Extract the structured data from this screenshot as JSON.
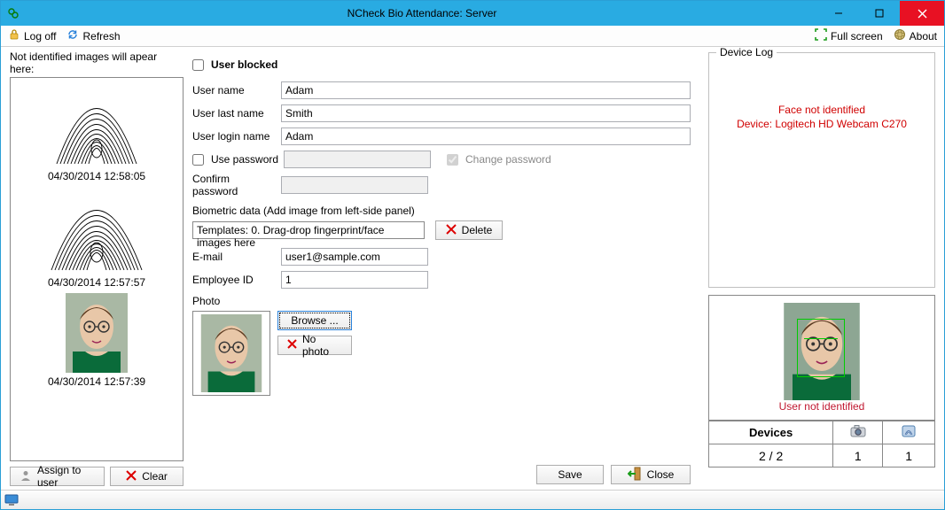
{
  "titlebar": {
    "title": "NCheck Bio Attendance: Server"
  },
  "toolbar": {
    "logoff": "Log off",
    "refresh": "Refresh",
    "fullscreen": "Full screen",
    "about": "About"
  },
  "left": {
    "header": "Not identified images will apear here:",
    "items": [
      {
        "caption": "04/30/2014 12:58:05",
        "type": "fingerprint"
      },
      {
        "caption": "04/30/2014 12:57:57",
        "type": "fingerprint"
      },
      {
        "caption": "04/30/2014 12:57:39",
        "type": "face"
      }
    ],
    "assign": "Assign to user",
    "clear": "Clear"
  },
  "form": {
    "user_blocked_label": "User blocked",
    "user_name_label": "User name",
    "user_name": "Adam",
    "last_name_label": "User last name",
    "last_name": "Smith",
    "login_label": "User login name",
    "login": "Adam",
    "use_password_label": "Use password",
    "change_password_label": "Change password",
    "confirm_password_label": "Confirm password",
    "biometric_label": "Biometric data (Add image from left-side panel)",
    "biometric_drop": "Templates: 0. Drag-drop fingerprint/face images here",
    "delete_label": "Delete",
    "email_label": "E-mail",
    "email": "user1@sample.com",
    "employee_id_label": "Employee ID",
    "employee_id": "1",
    "photo_label": "Photo",
    "browse_label": "Browse ...",
    "nophoto_label": "No photo",
    "save_label": "Save",
    "close_label": "Close"
  },
  "right": {
    "group_title": "Device Log",
    "msg1": "Face not identified",
    "msg2": "Device: Logitech HD Webcam C270",
    "cam_caption": "User not identified",
    "devices_label": "Devices",
    "devices_count": "2 / 2",
    "cam_count": "1",
    "fp_count": "1"
  }
}
